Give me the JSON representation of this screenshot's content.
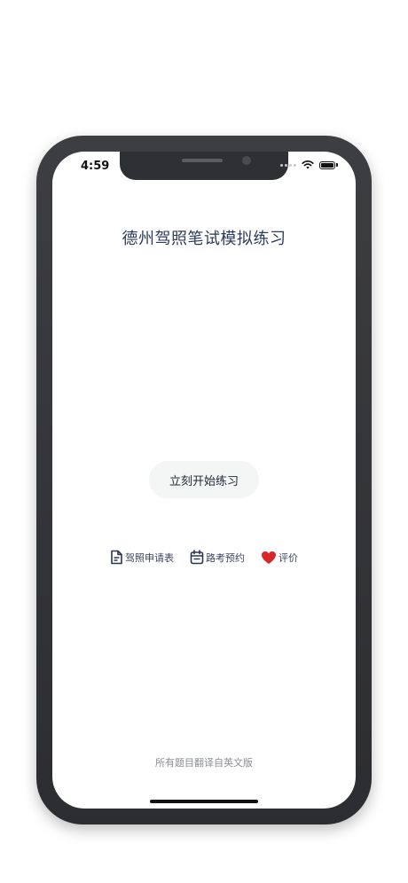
{
  "status_bar": {
    "time": "4:59"
  },
  "main": {
    "title": "德州驾照笔试模拟练习",
    "start_button_label": "立刻开始练习"
  },
  "links": [
    {
      "label": "驾照申请表",
      "icon": "document-icon"
    },
    {
      "label": "路考预约",
      "icon": "calendar-icon"
    },
    {
      "label": "评价",
      "icon": "heart-icon"
    }
  ],
  "footer": {
    "note": "所有题目翻译自英文版"
  },
  "colors": {
    "heart": "#d62828",
    "title_text": "#2d3a5a",
    "button_bg": "#f3f6f5"
  }
}
